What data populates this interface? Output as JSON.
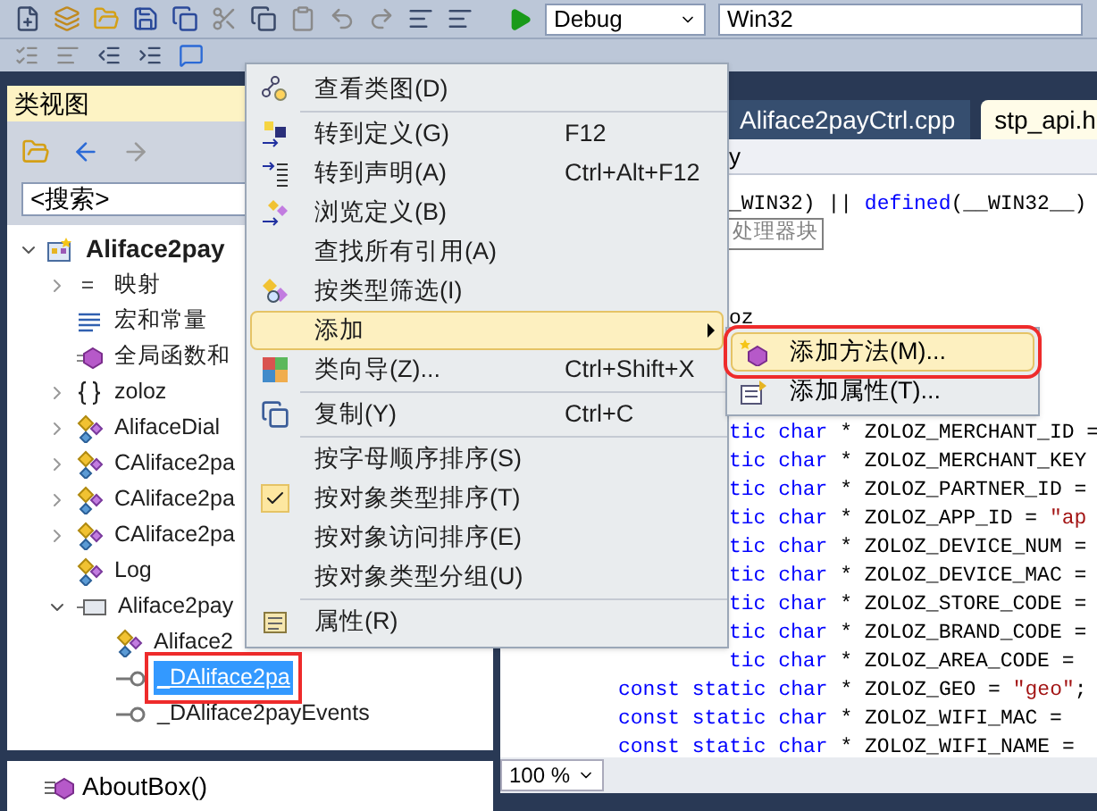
{
  "toolbar": {
    "configuration": "Debug",
    "platform": "Win32"
  },
  "class_view": {
    "title": "类视图",
    "search": {
      "placeholder": "<搜索>"
    },
    "tree": [
      {
        "label": "Aliface2pay",
        "kind": "project",
        "expanded": true,
        "selected": false,
        "annotated": false,
        "children": [
          {
            "label": "映射",
            "kind": "map",
            "expanded": false,
            "selected": false,
            "annotated": false
          },
          {
            "label": "宏和常量",
            "kind": "macro",
            "selected": false,
            "annotated": false
          },
          {
            "label": "全局函数和",
            "kind": "global",
            "selected": false,
            "annotated": false
          },
          {
            "label": "zoloz",
            "kind": "namespace",
            "expanded": false,
            "selected": false,
            "annotated": false
          },
          {
            "label": "AlifaceDial",
            "kind": "class",
            "expanded": false,
            "selected": false,
            "annotated": false
          },
          {
            "label": "CAliface2pa",
            "kind": "class",
            "expanded": false,
            "selected": false,
            "annotated": false
          },
          {
            "label": "CAliface2pa",
            "kind": "class",
            "expanded": false,
            "selected": false,
            "annotated": false
          },
          {
            "label": "CAliface2pa",
            "kind": "class",
            "expanded": false,
            "selected": false,
            "annotated": false
          },
          {
            "label": "Log",
            "kind": "class",
            "selected": false,
            "annotated": false
          },
          {
            "label": "Aliface2pay",
            "kind": "library",
            "expanded": true,
            "selected": false,
            "annotated": false,
            "children": [
              {
                "label": "Aliface2",
                "kind": "class",
                "selected": false,
                "annotated": false
              },
              {
                "label": "_DAliface2pa",
                "kind": "interface",
                "selected": true,
                "annotated": true
              },
              {
                "label": "_DAliface2payEvents",
                "kind": "interface",
                "selected": false,
                "annotated": false
              }
            ]
          }
        ]
      }
    ],
    "members": [
      {
        "label": "AboutBox()",
        "kind": "method"
      }
    ]
  },
  "editor": {
    "tabs": [
      {
        "label": "Aliface2payCtrl.cpp",
        "selected": false
      },
      {
        "label": "stp_api.h",
        "selected": true
      }
    ],
    "nav_text": "y",
    "lines": [
      {
        "kind": "clipped",
        "segments": [
          {
            "kind": "text",
            "text": "_WIN32) || "
          },
          {
            "kind": "keyword",
            "text": "defined"
          },
          {
            "kind": "text",
            "text": "(__WIN32__)"
          }
        ]
      },
      {
        "kind": "region",
        "segments": [
          {
            "kind": "comment",
            "text": "处理器块"
          }
        ]
      },
      {
        "kind": "blank"
      },
      {
        "kind": "blank"
      },
      {
        "kind": "clipped",
        "segments": [
          {
            "kind": "text",
            "text": "oz"
          }
        ]
      },
      {
        "kind": "blank"
      },
      {
        "kind": "blank"
      },
      {
        "kind": "blank"
      },
      {
        "kind": "clipped",
        "segments": [
          {
            "kind": "keyword",
            "text": "tic char"
          },
          {
            "kind": "text",
            "text": " * ZOLOZ_MERCHANT_ID ="
          }
        ]
      },
      {
        "kind": "clipped",
        "segments": [
          {
            "kind": "keyword",
            "text": "tic char"
          },
          {
            "kind": "text",
            "text": " * ZOLOZ_MERCHANT_KEY"
          }
        ]
      },
      {
        "kind": "clipped",
        "segments": [
          {
            "kind": "keyword",
            "text": "tic char"
          },
          {
            "kind": "text",
            "text": " * ZOLOZ_PARTNER_ID ="
          }
        ]
      },
      {
        "kind": "clipped",
        "segments": [
          {
            "kind": "keyword",
            "text": "tic char"
          },
          {
            "kind": "text",
            "text": " * ZOLOZ_APP_ID = "
          },
          {
            "kind": "string",
            "text": "\"ap"
          }
        ]
      },
      {
        "kind": "clipped",
        "segments": [
          {
            "kind": "keyword",
            "text": "tic char"
          },
          {
            "kind": "text",
            "text": " * ZOLOZ_DEVICE_NUM ="
          }
        ]
      },
      {
        "kind": "clipped",
        "segments": [
          {
            "kind": "keyword",
            "text": "tic char"
          },
          {
            "kind": "text",
            "text": " * ZOLOZ_DEVICE_MAC ="
          }
        ]
      },
      {
        "kind": "clipped",
        "segments": [
          {
            "kind": "keyword",
            "text": "tic char"
          },
          {
            "kind": "text",
            "text": " * ZOLOZ_STORE_CODE ="
          }
        ]
      },
      {
        "kind": "clipped",
        "segments": [
          {
            "kind": "keyword",
            "text": "tic char"
          },
          {
            "kind": "text",
            "text": " * ZOLOZ_BRAND_CODE ="
          }
        ]
      },
      {
        "kind": "clipped",
        "segments": [
          {
            "kind": "keyword",
            "text": "tic char"
          },
          {
            "kind": "text",
            "text": " * ZOLOZ_AREA_CODE ="
          }
        ]
      },
      {
        "kind": "full",
        "segments": [
          {
            "kind": "keyword",
            "text": "const static char"
          },
          {
            "kind": "text",
            "text": " * ZOLOZ_GEO = "
          },
          {
            "kind": "string",
            "text": "\"geo\""
          },
          {
            "kind": "text",
            "text": ";"
          }
        ]
      },
      {
        "kind": "full",
        "segments": [
          {
            "kind": "keyword",
            "text": "const static char"
          },
          {
            "kind": "text",
            "text": " * ZOLOZ_WIFI_MAC ="
          }
        ]
      },
      {
        "kind": "full",
        "segments": [
          {
            "kind": "keyword",
            "text": "const static char"
          },
          {
            "kind": "text",
            "text": " * ZOLOZ_WIFI_NAME ="
          }
        ]
      }
    ],
    "zoom": "100 %"
  },
  "context_menu": {
    "items": [
      {
        "kind": "item",
        "label": "查看类图(D)",
        "checked": false,
        "selected": false,
        "has_submenu": false
      },
      {
        "kind": "separator"
      },
      {
        "kind": "item",
        "label": "转到定义(G)",
        "shortcut": "F12",
        "checked": false,
        "selected": false,
        "has_submenu": false
      },
      {
        "kind": "item",
        "label": "转到声明(A)",
        "shortcut": "Ctrl+Alt+F12",
        "checked": false,
        "selected": false,
        "has_submenu": false
      },
      {
        "kind": "item",
        "label": "浏览定义(B)",
        "checked": false,
        "selected": false,
        "has_submenu": false
      },
      {
        "kind": "item",
        "label": "查找所有引用(A)",
        "checked": false,
        "selected": false,
        "has_submenu": false
      },
      {
        "kind": "item",
        "label": "按类型筛选(I)",
        "checked": false,
        "selected": false,
        "has_submenu": false
      },
      {
        "kind": "item",
        "label": "添加",
        "checked": false,
        "selected": true,
        "has_submenu": true
      },
      {
        "kind": "item",
        "label": "类向导(Z)...",
        "shortcut": "Ctrl+Shift+X",
        "checked": false,
        "selected": false,
        "has_submenu": false
      },
      {
        "kind": "separator"
      },
      {
        "kind": "item",
        "label": "复制(Y)",
        "shortcut": "Ctrl+C",
        "checked": false,
        "selected": false,
        "has_submenu": false
      },
      {
        "kind": "separator"
      },
      {
        "kind": "item",
        "label": "按字母顺序排序(S)",
        "checked": false,
        "selected": false,
        "has_submenu": false
      },
      {
        "kind": "item",
        "label": "按对象类型排序(T)",
        "checked": true,
        "selected": false,
        "has_submenu": false
      },
      {
        "kind": "item",
        "label": "按对象访问排序(E)",
        "checked": false,
        "selected": false,
        "has_submenu": false
      },
      {
        "kind": "item",
        "label": "按对象类型分组(U)",
        "checked": false,
        "selected": false,
        "has_submenu": false
      },
      {
        "kind": "separator"
      },
      {
        "kind": "item",
        "label": "属性(R)",
        "checked": false,
        "selected": false,
        "has_submenu": false
      }
    ]
  },
  "submenu": {
    "items": [
      {
        "label": "添加方法(M)...",
        "selected": true,
        "annotated": true
      },
      {
        "label": "添加属性(T)...",
        "selected": false,
        "annotated": false
      }
    ]
  }
}
